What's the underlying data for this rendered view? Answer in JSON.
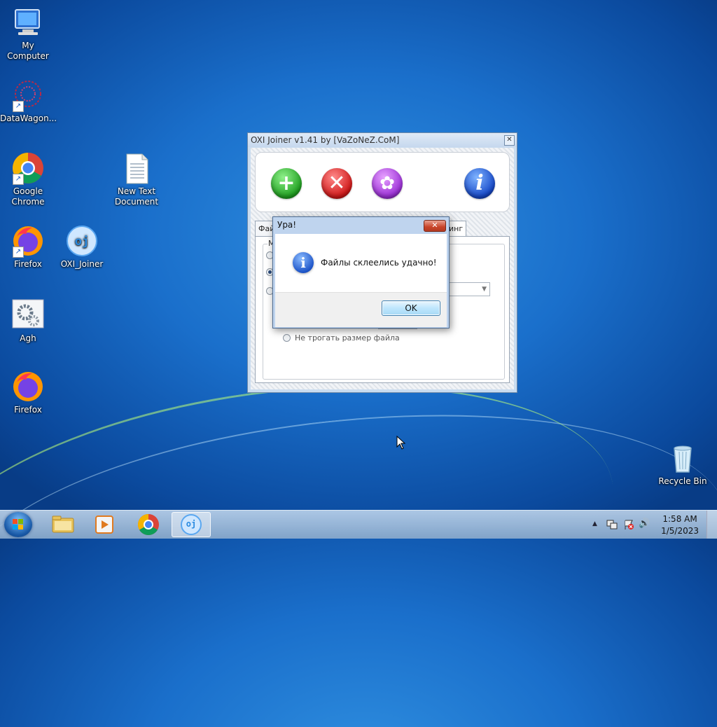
{
  "desktop": {
    "icons": [
      {
        "label": "My Computer"
      },
      {
        "label": "DataWagon..."
      },
      {
        "label": "Google Chrome"
      },
      {
        "label": "New Text Document"
      },
      {
        "label": "Firefox"
      },
      {
        "label": "OXI_Joiner"
      },
      {
        "label": "Agh"
      },
      {
        "label": "Firefox"
      },
      {
        "label": "Recycle Bin"
      }
    ]
  },
  "app": {
    "title": "OXI Joiner v1.41 by [VaZoNeZ.CoM]",
    "close_glyph": "✕",
    "tabs": [
      {
        "label": "Фай"
      },
      {
        "label": "инг"
      }
    ],
    "group_label": "М",
    "option_keep_size": "Не трогать размер файла",
    "toolbar": {
      "add_glyph": "+",
      "delete_glyph": "✕",
      "settings_glyph": "✿",
      "info_glyph": "i"
    },
    "combo_arrow": "▼"
  },
  "dialog": {
    "title": "Ура!",
    "close_glyph": "✕",
    "icon_glyph": "i",
    "message": "Файлы склеелись удачно!",
    "ok_label": "OK"
  },
  "taskbar": {
    "time": "1:58 AM",
    "date": "1/5/2023",
    "app_label": "oj",
    "tray_up": "▲",
    "tray_speaker": "🔊"
  },
  "colors": {
    "desktop_blue": "#1a6fcb",
    "dialog_frame": "#bfd4ee",
    "close_red": "#c8442a"
  }
}
